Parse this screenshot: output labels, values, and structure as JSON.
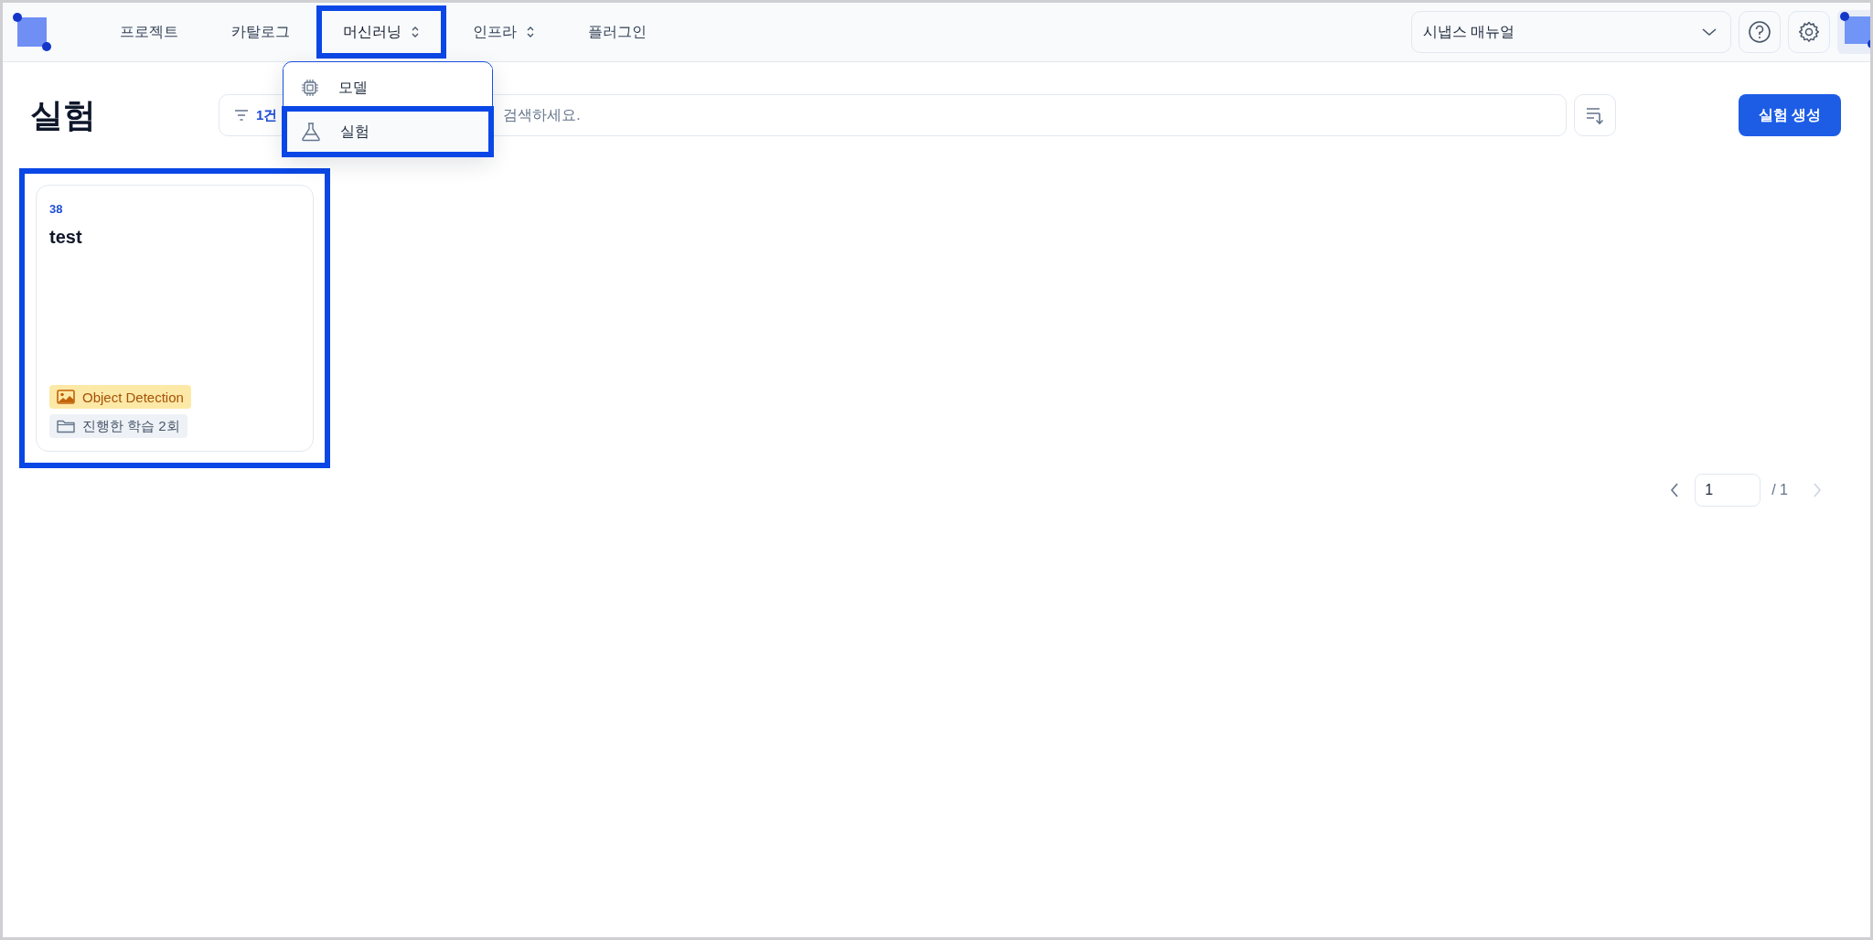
{
  "nav": {
    "items": [
      {
        "label": "프로젝트",
        "has_menu": false,
        "highlighted": false
      },
      {
        "label": "카탈로그",
        "has_menu": false,
        "highlighted": false
      },
      {
        "label": "머신러닝",
        "has_menu": true,
        "highlighted": true
      },
      {
        "label": "인프라",
        "has_menu": true,
        "highlighted": false
      },
      {
        "label": "플러그인",
        "has_menu": false,
        "highlighted": false
      }
    ]
  },
  "nav_menu": {
    "items": [
      {
        "label": "모델",
        "kind": "chip",
        "highlighted": false
      },
      {
        "label": "실험",
        "kind": "flask",
        "highlighted": true
      }
    ]
  },
  "manual_select": {
    "value": "시냅스 매뉴얼"
  },
  "page_title": "실험",
  "search": {
    "filter_label": "1건",
    "placeholder": "검색하세요."
  },
  "create_button": "실험 생성",
  "cards": [
    {
      "id": "38",
      "title": "test",
      "tag": "Object Detection",
      "runs": "진행한 학습 2회",
      "highlighted": true
    }
  ],
  "pagination": {
    "page": "1",
    "total": "/ 1"
  }
}
